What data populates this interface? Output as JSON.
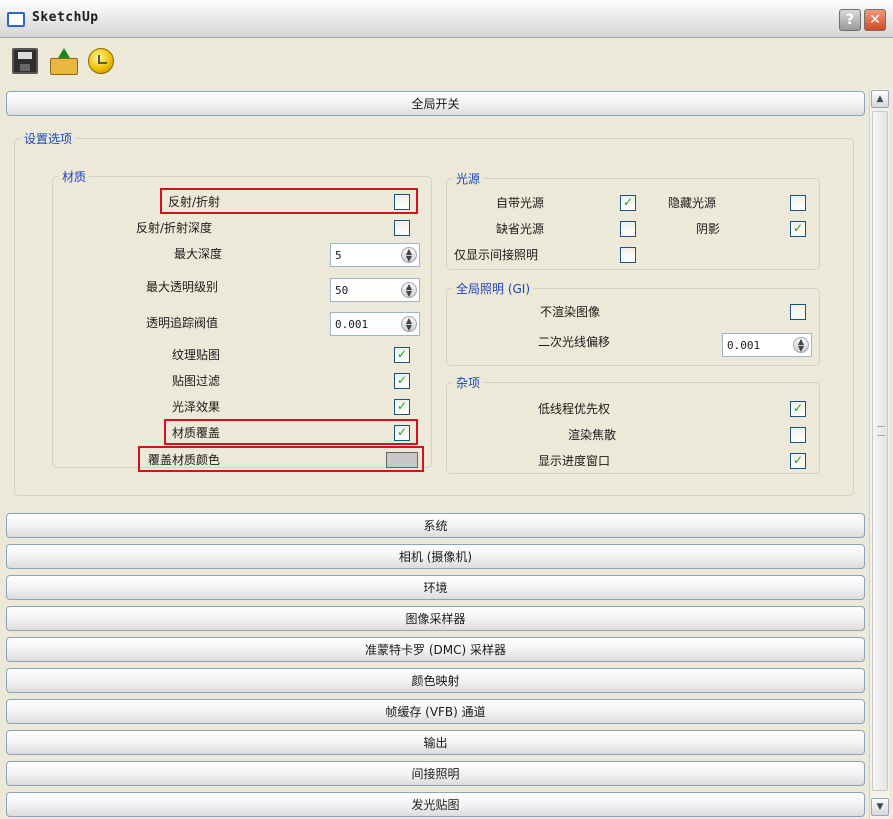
{
  "window": {
    "title": "SketchUp",
    "help_label": "?",
    "close_label": "✕"
  },
  "toolbar": {
    "icons": [
      "save-icon",
      "open-icon",
      "render-icon"
    ]
  },
  "sections_top": {
    "global_switches": "全局开关"
  },
  "settings": {
    "legend": "设置选项",
    "material": {
      "legend": "材质",
      "reflect_refract": {
        "label": "反射/折射",
        "checked": false
      },
      "reflect_refract_depth": {
        "label": "反射/折射深度",
        "checked": false
      },
      "max_depth": {
        "label": "最大深度",
        "value": "5"
      },
      "max_transparency": {
        "label": "最大透明级别",
        "value": "50"
      },
      "transparency_cutoff": {
        "label": "透明追踪阀值",
        "value": "0.001"
      },
      "texture_maps": {
        "label": "纹理贴图",
        "checked": true
      },
      "map_filtering": {
        "label": "贴图过滤",
        "checked": true
      },
      "glossy_effects": {
        "label": "光泽效果",
        "checked": true
      },
      "material_override": {
        "label": "材质覆盖",
        "checked": true
      },
      "override_color": {
        "label": "覆盖材质颜色",
        "color": "#c8c8c8"
      }
    },
    "lights": {
      "legend": "光源",
      "own_lights": {
        "label": "自带光源",
        "checked": true
      },
      "hidden_lights": {
        "label": "隐藏光源",
        "checked": false
      },
      "default_lights": {
        "label": "缺省光源",
        "checked": false
      },
      "shadows": {
        "label": "阴影",
        "checked": true
      },
      "show_gi_only": {
        "label": "仅显示间接照明",
        "checked": false
      }
    },
    "gi": {
      "legend": "全局照明 (GI)",
      "dont_render_image": {
        "label": "不渲染图像",
        "checked": false
      },
      "secondary_ray_bias": {
        "label": "二次光线偏移",
        "value": "0.001"
      }
    },
    "misc": {
      "legend": "杂项",
      "low_thread_priority": {
        "label": "低线程优先权",
        "checked": true
      },
      "render_caustics": {
        "label": "渲染焦散",
        "checked": false
      },
      "show_progress_window": {
        "label": "显示进度窗口",
        "checked": true
      }
    }
  },
  "sections_bottom": [
    "系统",
    "相机 (摄像机)",
    "环境",
    "图像采样器",
    "准蒙特卡罗 (DMC) 采样器",
    "颜色映射",
    "帧缓存 (VFB) 通道",
    "输出",
    "间接照明",
    "发光贴图"
  ],
  "highlight_color": "#d8101d"
}
